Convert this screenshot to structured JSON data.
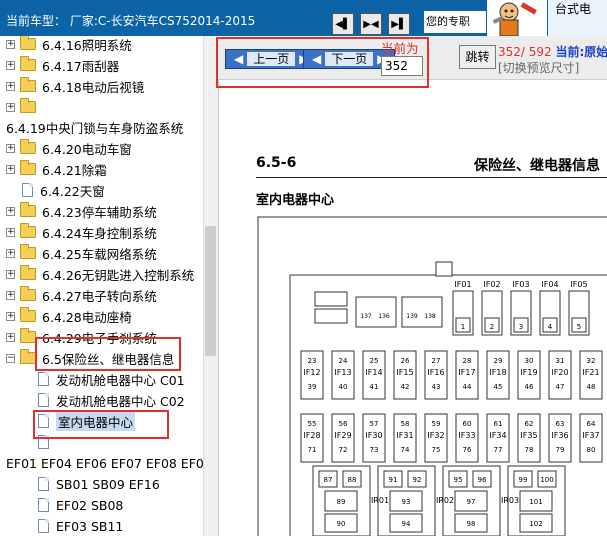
{
  "header": {
    "car_label": "当前车型：  厂家:C-长安汽车CS752014-2015",
    "nav_icons": [
      "first-page-icon",
      "split-view-icon",
      "next-page-icon"
    ],
    "pro_label": "您的专职",
    "panel_label": "台式电",
    "colors": {
      "bar": "#0c64a6",
      "highlight": "#e03030",
      "selection": "#c5d9f1"
    }
  },
  "tree": {
    "items": [
      {
        "label": "6.4.16照明系统",
        "kind": "folder",
        "expander": "+"
      },
      {
        "label": "6.4.17雨刮器",
        "kind": "folder",
        "expander": "+"
      },
      {
        "label": "6.4.18电动后视镜",
        "kind": "folder",
        "expander": "+"
      },
      {
        "label": "",
        "kind": "folder",
        "expander": "+"
      },
      {
        "label": "6.4.19中央门锁与车身防盗系统",
        "kind": "text"
      },
      {
        "label": "6.4.20电动车窗",
        "kind": "folder",
        "expander": "+"
      },
      {
        "label": "6.4.21除霜",
        "kind": "folder",
        "expander": "+"
      },
      {
        "label": "6.4.22天窗",
        "kind": "doc"
      },
      {
        "label": "6.4.23停车辅助系统",
        "kind": "folder",
        "expander": "+"
      },
      {
        "label": "6.4.24车身控制系统",
        "kind": "folder",
        "expander": "+"
      },
      {
        "label": "6.4.25车载网络系统",
        "kind": "folder",
        "expander": "+"
      },
      {
        "label": "6.4.26无钥匙进入控制系统",
        "kind": "folder",
        "expander": "+"
      },
      {
        "label": "6.4.27电子转向系统",
        "kind": "folder",
        "expander": "+"
      },
      {
        "label": "6.4.28电动座椅",
        "kind": "folder",
        "expander": "+"
      },
      {
        "label": "6.4.29电子手刹系统",
        "kind": "folder",
        "expander": "+"
      },
      {
        "label": "6.5保险丝、继电器信息",
        "kind": "folder",
        "expander": "−"
      },
      {
        "label": "发动机舱电器中心 C01",
        "kind": "doc"
      },
      {
        "label": "发动机舱电器中心 C02",
        "kind": "doc"
      },
      {
        "label": "室内电器中心",
        "kind": "doc",
        "selected": true
      },
      {
        "label": "",
        "kind": "doc"
      },
      {
        "label": "EF01 EF04 EF06 EF07 EF08 EF09",
        "kind": "text"
      },
      {
        "label": "SB01 SB09 EF16",
        "kind": "doc"
      },
      {
        "label": "EF02 SB08",
        "kind": "doc"
      },
      {
        "label": "EF03 SB11",
        "kind": "doc"
      }
    ]
  },
  "pager": {
    "prev_label": "上一页",
    "next_label": "下一页",
    "current_label": "当前为",
    "page_value": "352",
    "jump_label": "跳转",
    "page_count": "352/ 592",
    "current_link": "当前:原始",
    "preview_link": "[切换预览尺寸]"
  },
  "document": {
    "section": "6.5-6",
    "title": "保险丝、继电器信息",
    "subtitle": "室内电器中心",
    "fuse_top": [
      "IF01",
      "IF02",
      "IF03",
      "IF04",
      "IF05"
    ],
    "fuse_top_nums": [
      "1",
      "2",
      "3",
      "4",
      "5"
    ],
    "relay_pairs": [
      [
        "137",
        "136"
      ],
      [
        "139",
        "138"
      ]
    ],
    "row1_top": [
      "23",
      "24",
      "25",
      "26",
      "27",
      "28",
      "29",
      "30",
      "31",
      "32"
    ],
    "row1_labels": [
      "IF12",
      "IF13",
      "IF14",
      "IF15",
      "IF16",
      "IF17",
      "IF18",
      "IF19",
      "IF20",
      "IF21"
    ],
    "row1_bottom": [
      "39",
      "40",
      "41",
      "42",
      "43",
      "44",
      "45",
      "46",
      "47",
      "48"
    ],
    "row2_top": [
      "55",
      "56",
      "57",
      "58",
      "59",
      "60",
      "61",
      "62",
      "63",
      "64"
    ],
    "row2_labels": [
      "IF28",
      "IF29",
      "IF30",
      "IF31",
      "IF32",
      "IF33",
      "IF34",
      "IF35",
      "IF36",
      "IF37"
    ],
    "row2_bottom": [
      "71",
      "72",
      "73",
      "74",
      "75",
      "76",
      "77",
      "78",
      "79",
      "80"
    ],
    "relay_blocks": [
      {
        "nums": [
          "87",
          "88",
          "89",
          "90"
        ]
      },
      {
        "nums": [
          "91",
          "92",
          "93",
          "94"
        ]
      },
      {
        "nums": [
          "95",
          "96",
          "97",
          "98"
        ]
      },
      {
        "nums": [
          "99",
          "100",
          "101",
          "102"
        ]
      }
    ],
    "relay_labels": [
      "IR01",
      "IR02",
      "IR03"
    ]
  }
}
